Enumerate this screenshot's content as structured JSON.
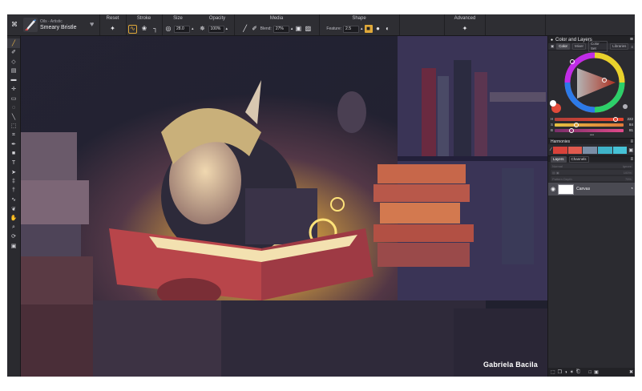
{
  "brush": {
    "category": "Oils - Artistic",
    "name": "Smeary Bristle",
    "favorite_icon": "heart-icon"
  },
  "toolbar": {
    "reset": {
      "title": "Reset",
      "icon": "reset-brush-icon"
    },
    "stroke": {
      "title": "Stroke"
    },
    "size": {
      "title": "Size",
      "value": "28.0"
    },
    "opacity": {
      "title": "Opacity",
      "value": "100%"
    },
    "media": {
      "title": "Media",
      "blend_label": "Blend:",
      "blend_value": "27%"
    },
    "shape": {
      "title": "Shape",
      "feature_label": "Feature:",
      "feature_value": "2.5"
    },
    "advanced": {
      "title": "Advanced",
      "icon": "brush-settings-icon"
    }
  },
  "tools": [
    "paint-brush-icon",
    "blender-icon",
    "eraser-icon",
    "fill-icon",
    "eraser-block-icon",
    "move-icon",
    "select-rect-icon",
    "lasso-icon",
    "line-icon",
    "transform-icon",
    "crop-icon",
    "pen-icon",
    "shape-icon",
    "text-icon",
    "pointer-icon",
    "eyedropper-icon",
    "dropper-icon",
    "liquify-icon",
    "smudge-icon",
    "hand-icon",
    "zoom-icon",
    "rotate-icon",
    "reference-icon"
  ],
  "artwork": {
    "signature": "Gabriela Bacila"
  },
  "panel": {
    "title": "Color and Layers",
    "color_tabs": [
      "Color",
      "Mixer",
      "Color Set",
      "Libraries"
    ],
    "active_color_tab": "Color",
    "sliders": [
      {
        "label": "H",
        "value": "222",
        "pos": 0.88,
        "color": "#e8432e"
      },
      {
        "label": "S",
        "value": "84",
        "pos": 0.31,
        "color": "#e5a63c"
      },
      {
        "label": "B",
        "value": "81",
        "pos": 0.24,
        "color": "#d94a8a"
      }
    ],
    "harmonies_title": "Harmonies",
    "swatches": [
      "#d8423a",
      "#e05a4e",
      "#7a8ea6",
      "#3fb3c9",
      "#46c2d6"
    ],
    "layers_tabs": [
      "Layers",
      "Channels"
    ],
    "blend_mode": "Normal",
    "lock_label": "Ignore",
    "opacity_value": "100%",
    "depth_label": "Pattern Depth",
    "depth_value": "75%",
    "layer_name": "Canvas"
  }
}
